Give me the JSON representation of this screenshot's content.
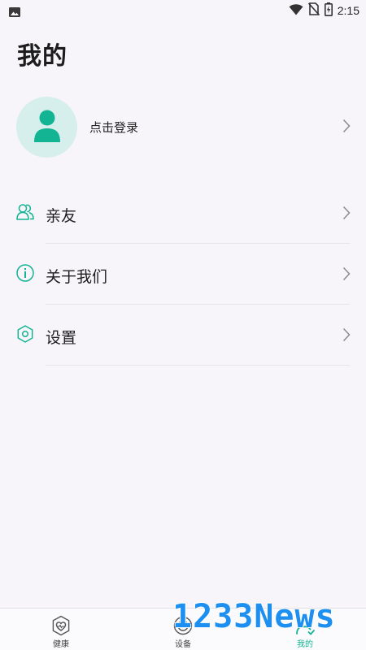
{
  "status_bar": {
    "time": "2:15",
    "icons": [
      "gallery-icon",
      "wifi-icon",
      "no-sim-icon",
      "battery-charging-icon"
    ]
  },
  "page": {
    "title": "我的"
  },
  "login": {
    "text": "点击登录",
    "avatar_icon": "person-icon"
  },
  "menu": {
    "items": [
      {
        "label": "亲友",
        "icon": "friends-icon"
      },
      {
        "label": "关于我们",
        "icon": "info-icon"
      },
      {
        "label": "设置",
        "icon": "settings-hexagon-icon"
      }
    ]
  },
  "bottom_nav": {
    "items": [
      {
        "label": "健康",
        "icon": "health-icon",
        "active": false
      },
      {
        "label": "设备",
        "icon": "device-icon",
        "active": false
      },
      {
        "label": "我的",
        "icon": "profile-icon",
        "active": true
      }
    ]
  },
  "watermark": {
    "text": "1233News"
  },
  "colors": {
    "accent": "#12b493",
    "avatar_bg": "#d6efec",
    "background": "#f7f5f9",
    "watermark": "#1c8ff0"
  }
}
